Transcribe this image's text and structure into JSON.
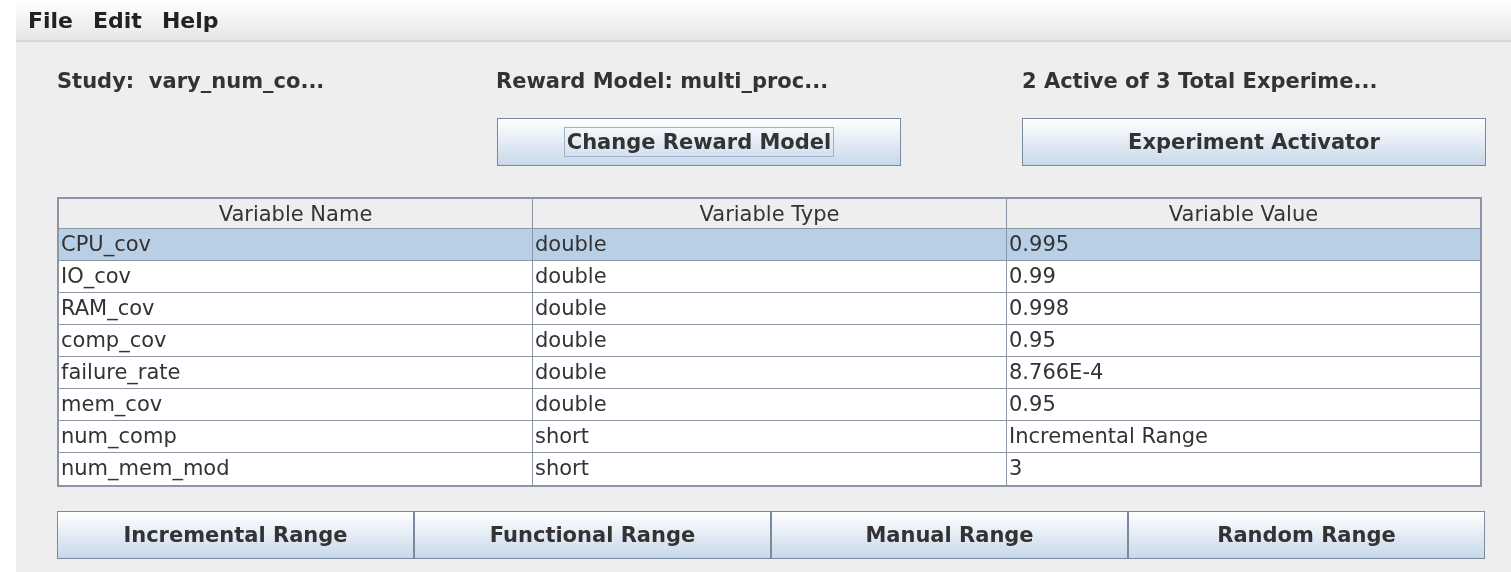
{
  "menu": [
    "File",
    "Edit",
    "Help"
  ],
  "info": {
    "study": "Study:  vary_num_co...",
    "reward_model": "Reward Model: multi_proc...",
    "experiments": "2 Active of 3 Total Experime..."
  },
  "top_buttons": [
    {
      "label": "Change Reward Model",
      "focused": true
    },
    {
      "label": "Experiment Activator",
      "focused": false
    }
  ],
  "table": {
    "columns": [
      "Variable Name",
      "Variable Type",
      "Variable Value"
    ],
    "rows": [
      {
        "cells": [
          "CPU_cov",
          "double",
          "0.995"
        ],
        "selected": true
      },
      {
        "cells": [
          "IO_cov",
          "double",
          "0.99"
        ],
        "selected": false
      },
      {
        "cells": [
          "RAM_cov",
          "double",
          "0.998"
        ],
        "selected": false
      },
      {
        "cells": [
          "comp_cov",
          "double",
          "0.95"
        ],
        "selected": false
      },
      {
        "cells": [
          "failure_rate",
          "double",
          "8.766E-4"
        ],
        "selected": false
      },
      {
        "cells": [
          "mem_cov",
          "double",
          "0.95"
        ],
        "selected": false
      },
      {
        "cells": [
          "num_comp",
          "short",
          "Incremental Range"
        ],
        "selected": false
      },
      {
        "cells": [
          "num_mem_mod",
          "short",
          "3"
        ],
        "selected": false
      }
    ]
  },
  "range_buttons": [
    "Incremental Range",
    "Functional Range",
    "Manual Range",
    "Random Range"
  ]
}
